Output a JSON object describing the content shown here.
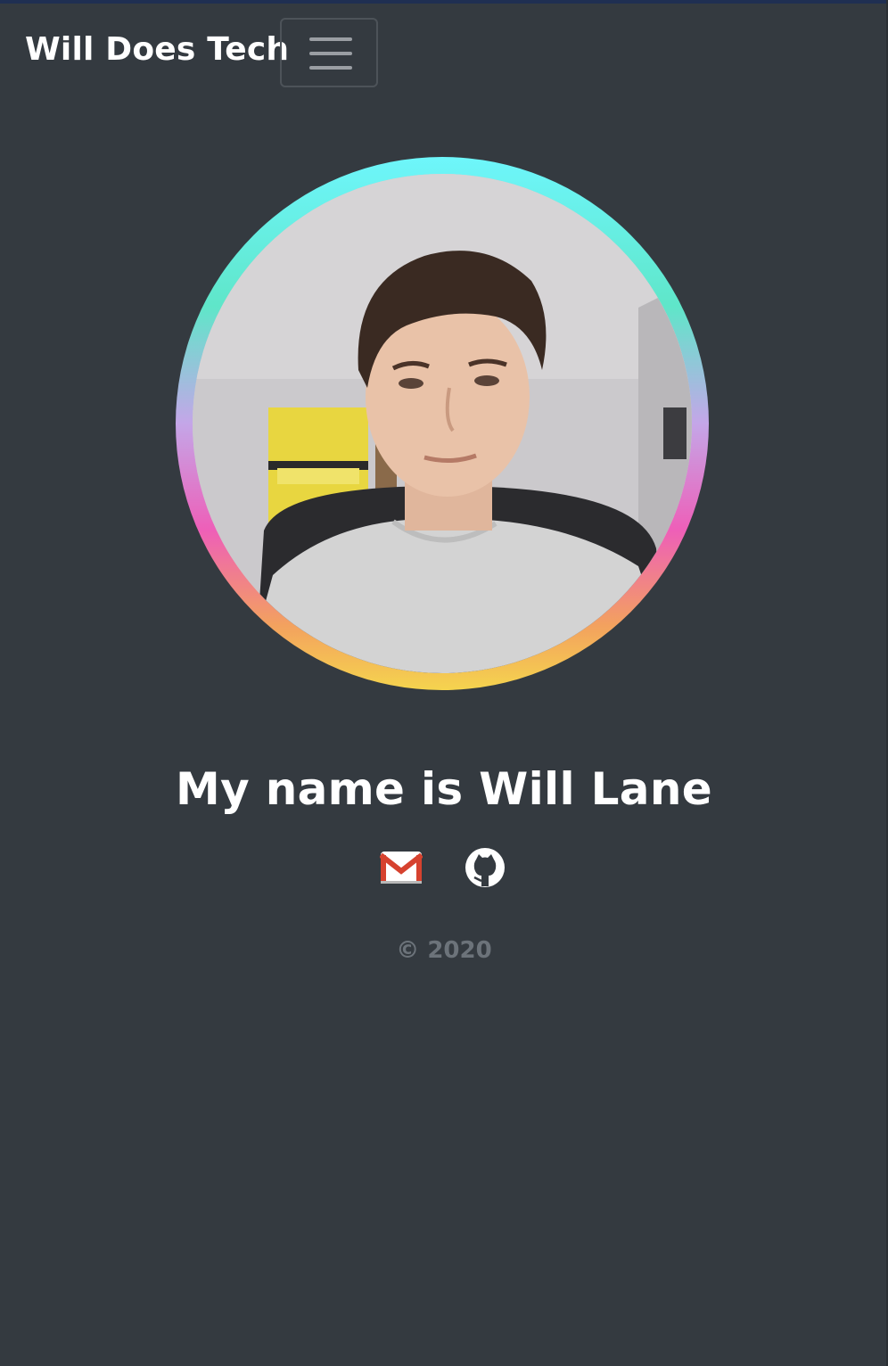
{
  "navbar": {
    "brand": "Will Does Tech",
    "toggle_icon": "hamburger-menu-icon"
  },
  "profile": {
    "photo_icon": "profile-photo",
    "ring_colors": [
      "#6ef6fb",
      "#5fe6c9",
      "#c4a6e8",
      "#ee5fb8",
      "#f3a25e",
      "#f5d44e"
    ],
    "heading": "My name is Will Lane"
  },
  "social": [
    {
      "icon": "gmail-icon"
    },
    {
      "icon": "github-icon"
    }
  ],
  "footer": {
    "text": "© 2020"
  },
  "colors": {
    "background": "#343a40",
    "footer_text": "#6c737a"
  }
}
